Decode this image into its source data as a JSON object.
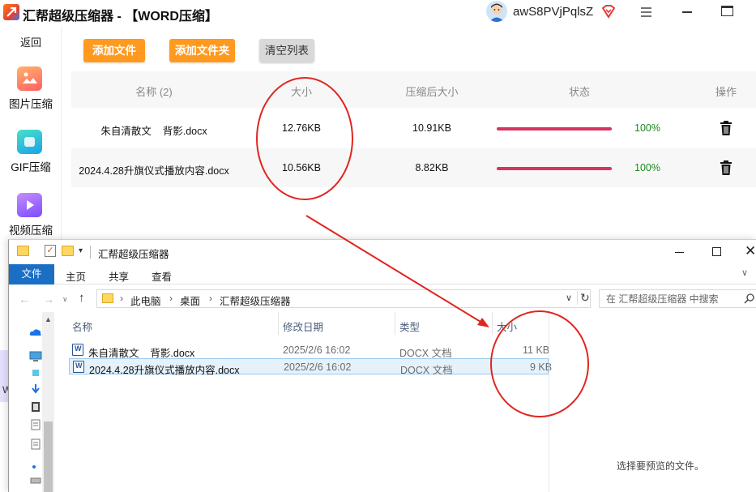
{
  "app": {
    "title": "汇帮超级压缩器  - 【WORD压缩】",
    "username": "awS8PVjPqlsZ"
  },
  "sidebar": {
    "back_label": "返回",
    "items": [
      {
        "label": "图片压缩",
        "icon": "image-icon"
      },
      {
        "label": "GIF压缩",
        "icon": "gif-icon"
      },
      {
        "label": "视频压缩",
        "icon": "video-icon"
      }
    ],
    "partial_letter": "W"
  },
  "toolbar": {
    "add_file": "添加文件",
    "add_folder": "添加文件夹",
    "clear_list": "清空列表"
  },
  "table": {
    "columns": [
      "名称 (2)",
      "大小",
      "压缩后大小",
      "状态",
      "操作"
    ],
    "rows": [
      {
        "name": "朱自清散文    背影.docx",
        "size": "12.76KB",
        "compressed": "10.91KB",
        "progress": 1.0,
        "status": "100%"
      },
      {
        "name": "2024.4.28升旗仪式播放内容.docx",
        "size": "10.56KB",
        "compressed": "8.82KB",
        "progress": 1.0,
        "status": "100%"
      }
    ]
  },
  "explorer": {
    "title": "汇帮超级压缩器",
    "ribbon_tabs": [
      "文件",
      "主页",
      "共享",
      "查看"
    ],
    "breadcrumb": [
      "此电脑",
      "桌面",
      "汇帮超级压缩器"
    ],
    "search_placeholder": "在 汇帮超级压缩器 中搜索",
    "columns": [
      "名称",
      "修改日期",
      "类型",
      "大小"
    ],
    "files": [
      {
        "name": "朱自清散文    背影.docx",
        "date": "2025/2/6 16:02",
        "type": "DOCX 文档",
        "size": "11 KB"
      },
      {
        "name": "2024.4.28升旗仪式播放内容.docx",
        "date": "2025/2/6 16:02",
        "type": "DOCX 文档",
        "size": "9 KB"
      }
    ],
    "preview_text": "选择要预览的文件。"
  },
  "colors": {
    "accent_orange": "#ff9a1f",
    "progress": "#d8335d",
    "status_green": "#1a8a1a",
    "annotation_red": "#e0261f",
    "ribbon_blue": "#1a6fc4"
  }
}
